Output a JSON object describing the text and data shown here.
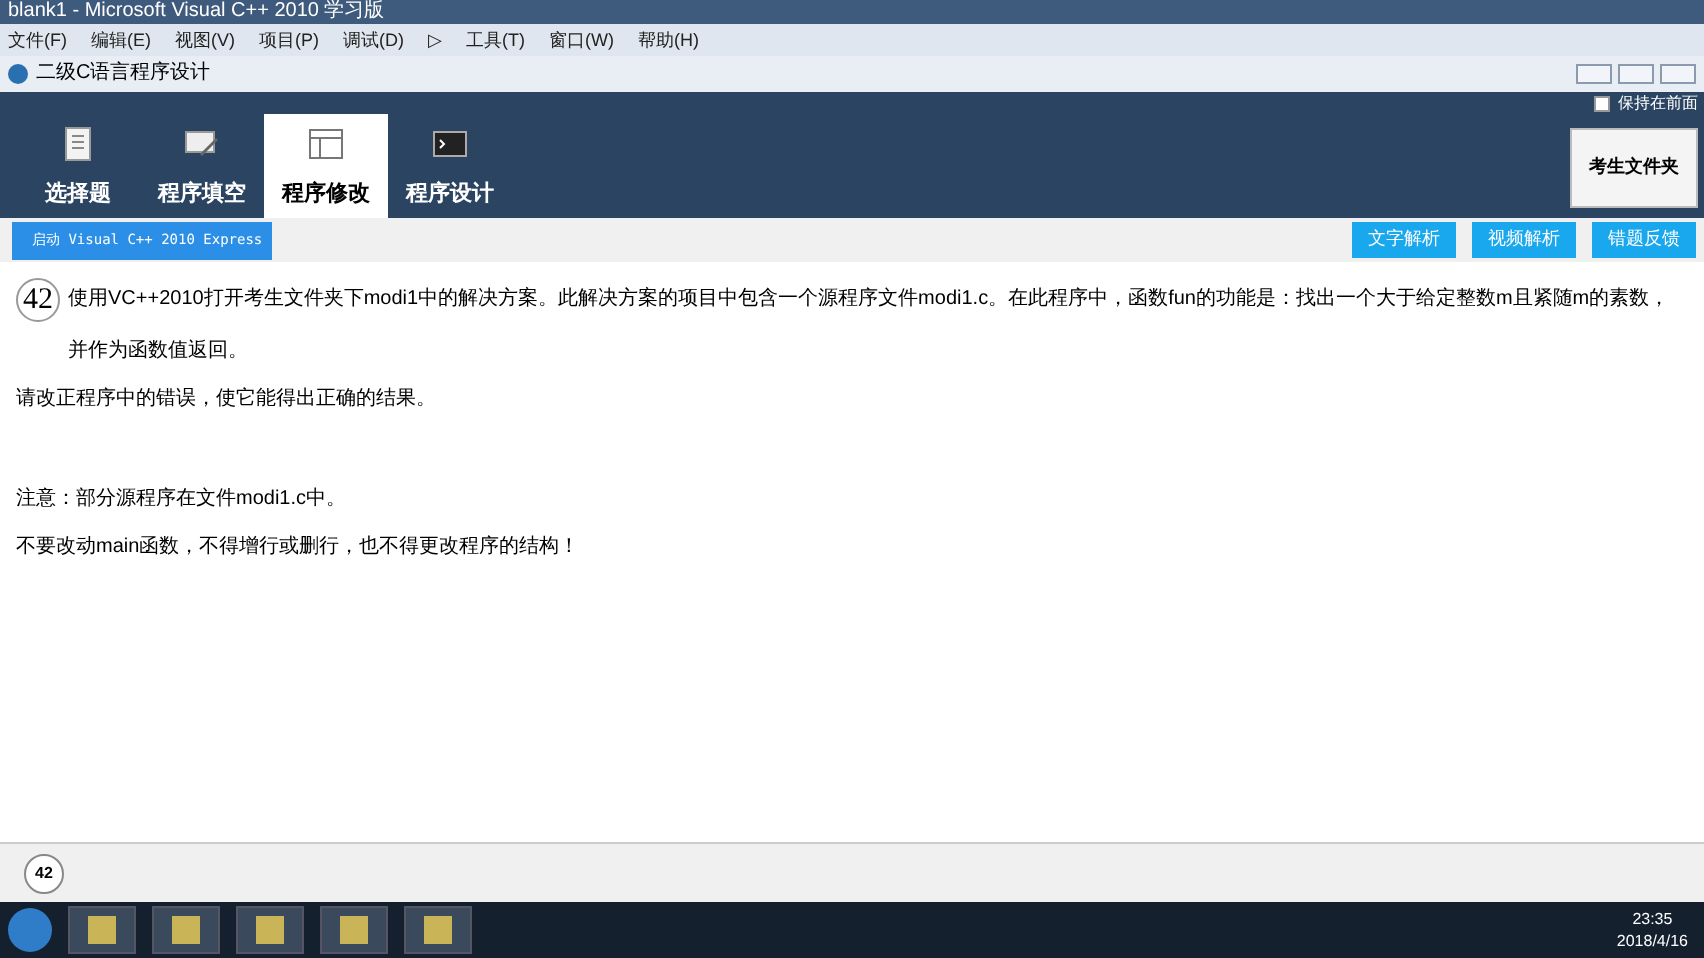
{
  "window": {
    "title": "blank1 - Microsoft Visual C++ 2010 学习版"
  },
  "menu": [
    "文件(F)",
    "编辑(E)",
    "视图(V)",
    "项目(P)",
    "调试(D)",
    "▷",
    "工具(T)",
    "窗口(W)",
    "帮助(H)"
  ],
  "app_window": {
    "title": "二级C语言程序设计"
  },
  "tabs": [
    {
      "label": "选择题",
      "kind": "list",
      "selected": false
    },
    {
      "label": "程序填空",
      "kind": "pen",
      "selected": false
    },
    {
      "label": "程序修改",
      "kind": "window",
      "selected": true
    },
    {
      "label": "程序设计",
      "kind": "terminal",
      "selected": false
    }
  ],
  "keep_on_top": {
    "label": "保持在前面",
    "checked": false
  },
  "folder_button": "考生文件夹",
  "launch_button": "启动 Visual C++ 2010 Express",
  "action_buttons": [
    "文字解析",
    "视频解析",
    "错题反馈"
  ],
  "question": {
    "number": "42",
    "paragraphs": [
      "使用VC++2010打开考生文件夹下modi1中的解决方案。此解决方案的项目中包含一个源程序文件modi1.c。在此程序中，函数fun的功能是：找出一个大于给定整数m且紧随m的素数，并作为函数值返回。",
      "请改正程序中的错误，使它能得出正确的结果。",
      "注意：部分源程序在文件modi1.c中。",
      "不要改动main函数，不得增行或删行，也不得更改程序的结构！"
    ]
  },
  "footer": {
    "question_number": "42"
  },
  "taskbar": {
    "time": "23:35",
    "date": "2018/4/16"
  }
}
